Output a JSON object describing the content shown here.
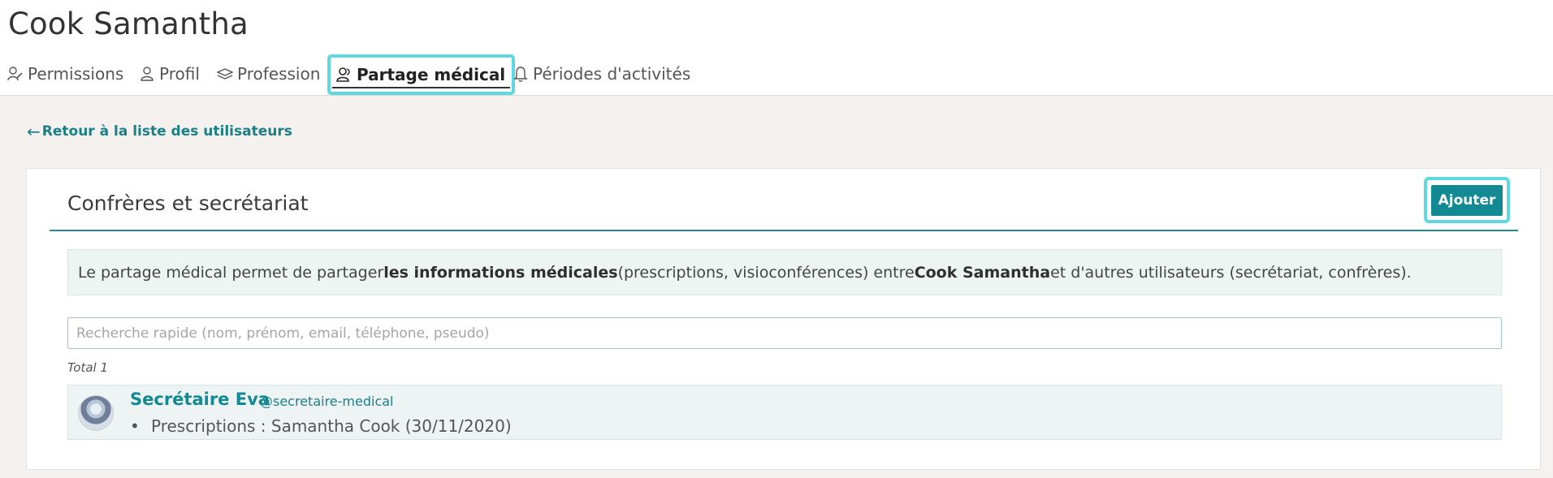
{
  "page": {
    "title": "Cook Samantha"
  },
  "tabs": [
    {
      "label": "Permissions",
      "icon": "user-edit-icon"
    },
    {
      "label": "Profil",
      "icon": "user-icon"
    },
    {
      "label": "Profession",
      "icon": "layers-icon"
    },
    {
      "label": "Partage médical",
      "icon": "users-icon",
      "active": true
    },
    {
      "label": "Périodes d'activités",
      "icon": "bell-icon"
    }
  ],
  "back_link": {
    "arrow": "←",
    "label": "Retour à la liste des utilisateurs"
  },
  "section": {
    "title": "Confrères et secrétariat",
    "add_label": "Ajouter"
  },
  "info": {
    "part1": "Le partage médical permet de partager ",
    "bold1": "les informations médicales",
    "part2": " (prescriptions, visioconférences) entre ",
    "bold2": "Cook Samantha",
    "part3": " et d'autres utilisateurs (secrétariat, confrères)."
  },
  "search": {
    "placeholder": "Recherche rapide (nom, prénom, email, téléphone, pseudo)"
  },
  "total_label": "Total 1",
  "users": [
    {
      "name": "Secrétaire Eva",
      "handle": "@secretaire-medical",
      "bullet": "•",
      "detail": "Prescriptions : Samantha Cook (30/11/2020)"
    }
  ],
  "colors": {
    "accent": "#138a93",
    "highlight": "#5fd8e2",
    "background": "#f4f1ef"
  }
}
